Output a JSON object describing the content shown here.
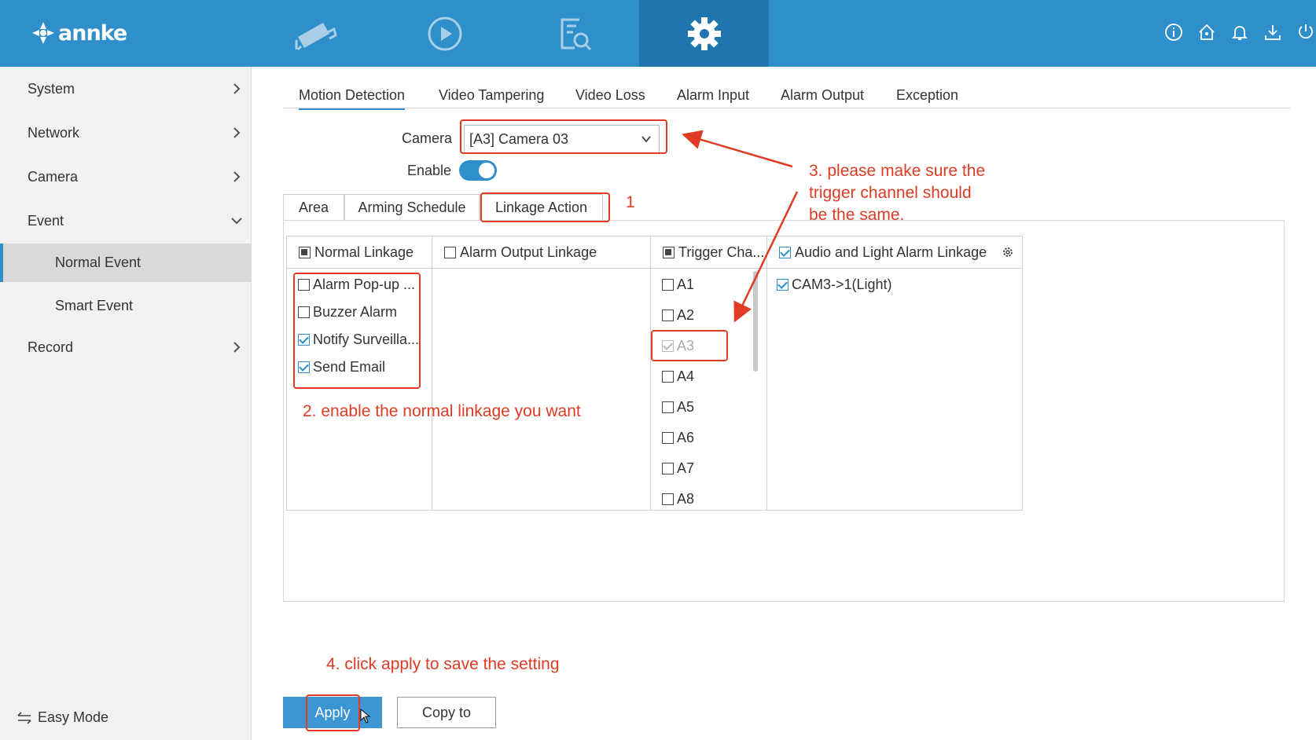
{
  "brand": {
    "logo_text": "annke",
    "primary_color": "#2f8fca",
    "annotation_color": "#e03b24"
  },
  "topbar": {
    "nav": [
      {
        "icon": "camera-icon"
      },
      {
        "icon": "playback-icon"
      },
      {
        "icon": "search-file-icon"
      },
      {
        "icon": "gear-icon",
        "active": true
      }
    ],
    "right_icons": [
      "info-icon",
      "home-icon",
      "bell-icon",
      "download-icon",
      "power-icon"
    ]
  },
  "sidebar": {
    "items": [
      {
        "label": "System"
      },
      {
        "label": "Network"
      },
      {
        "label": "Camera"
      },
      {
        "label": "Event",
        "expanded": true
      },
      {
        "label": "Record"
      }
    ],
    "event_children": [
      {
        "label": "Normal Event",
        "active": true
      },
      {
        "label": "Smart Event"
      }
    ],
    "easy_mode": "Easy Mode"
  },
  "tabs": [
    "Motion Detection",
    "Video Tampering",
    "Video Loss",
    "Alarm Input",
    "Alarm Output",
    "Exception"
  ],
  "form": {
    "camera_label": "Camera",
    "camera_value": "[A3] Camera 03",
    "enable_label": "Enable",
    "enable_on": true
  },
  "sub_tabs": [
    "Area",
    "Arming Schedule",
    "Linkage Action"
  ],
  "linkage": {
    "normal": {
      "header": "Normal Linkage",
      "items": [
        {
          "label": "Alarm Pop-up ...",
          "checked": false
        },
        {
          "label": "Buzzer Alarm",
          "checked": false
        },
        {
          "label": "Notify Surveilla...",
          "checked": true
        },
        {
          "label": "Send Email",
          "checked": true
        }
      ]
    },
    "alarm_output": {
      "header": "Alarm Output Linkage"
    },
    "trigger": {
      "header": "Trigger Cha...",
      "items": [
        {
          "label": "A1",
          "checked": false
        },
        {
          "label": "A2",
          "checked": false
        },
        {
          "label": "A3",
          "checked": true,
          "disabled": true
        },
        {
          "label": "A4",
          "checked": false
        },
        {
          "label": "A5",
          "checked": false
        },
        {
          "label": "A6",
          "checked": false
        },
        {
          "label": "A7",
          "checked": false
        },
        {
          "label": "A8",
          "checked": false
        }
      ]
    },
    "audio_light": {
      "header": "Audio and Light Alarm Linkage",
      "items": [
        {
          "label": "CAM3->1(Light)",
          "checked": true
        }
      ]
    }
  },
  "annotations": {
    "step1": "1",
    "step2": "2. enable the normal linkage you want",
    "step3_line1": "3. please make sure the",
    "step3_line2": "trigger channel should",
    "step3_line3": "be the same.",
    "step4": "4. click apply to save the setting"
  },
  "buttons": {
    "apply": "Apply",
    "copy_to": "Copy to"
  }
}
